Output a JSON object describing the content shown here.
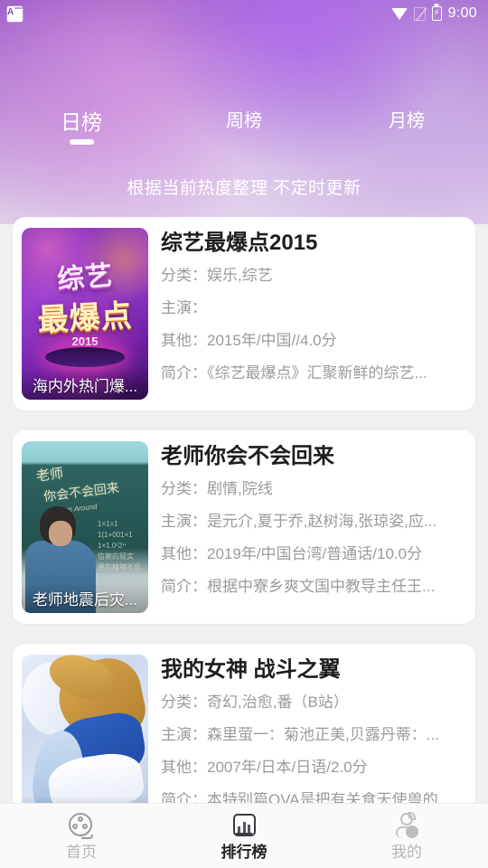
{
  "status_bar": {
    "app_icon": "app-notification-icon",
    "wifi_icon": "wifi-icon",
    "signal_icon": "no-sim-signal-icon",
    "battery_icon": "battery-charging-icon",
    "time": "9:00"
  },
  "header": {
    "tabs": [
      {
        "label": "日榜",
        "active": true
      },
      {
        "label": "周榜",
        "active": false
      },
      {
        "label": "月榜",
        "active": false
      }
    ],
    "subtitle": "根据当前热度整理 不定时更新",
    "accent_color": "#ffffff",
    "gradient_from": "#9757c4",
    "gradient_to": "#e3d5ea"
  },
  "list": {
    "items": [
      {
        "title": "综艺最爆点2015",
        "poster_caption": "海内外热门爆...",
        "poster_title_line1": "综艺",
        "poster_title_line2": "最爆点",
        "poster_year": "2015",
        "rows": [
          {
            "label": "分类：",
            "value": "娱乐,综艺"
          },
          {
            "label": "主演：",
            "value": ""
          },
          {
            "label": "其他：",
            "value": "2015年/中国//4.0分"
          },
          {
            "label": "简介：",
            "value": "《综艺最爆点》汇聚新鲜的综艺..."
          }
        ]
      },
      {
        "title": "老师你会不会回来",
        "poster_caption": "老师地震后灾...",
        "poster_chalk_line1": "老师",
        "poster_chalk_line2": "你会不会回来",
        "poster_chalk_sub": "Turn Around",
        "poster_equations": "1×1=1\n1(1+001×1.n1\n1×1.01^2×2...\n信赖nn1的现实\n患n精神不乐",
        "rows": [
          {
            "label": "分类：",
            "value": "剧情,院线"
          },
          {
            "label": "主演：",
            "value": "是元介,夏于乔,赵树海,张琼姿,应..."
          },
          {
            "label": "其他：",
            "value": "2019年/中国台湾/普通话/10.0分"
          },
          {
            "label": "简介：",
            "value": "根据中寮乡爽文国中教导主任王..."
          }
        ]
      },
      {
        "title": "我的女神 战斗之翼",
        "poster_caption": "",
        "rows": [
          {
            "label": "分类：",
            "value": "奇幻,治愈,番（B站）"
          },
          {
            "label": "主演：",
            "value": "森里萤一：菊池正美,贝露丹蒂：..."
          },
          {
            "label": "其他：",
            "value": "2007年/日本/日语/2.0分"
          },
          {
            "label": "简介：",
            "value": "本特别篇OVA是把有关食天使兽的..."
          }
        ]
      }
    ]
  },
  "bottom_nav": {
    "items": [
      {
        "label": "首页",
        "icon": "film-reel-icon",
        "active": false
      },
      {
        "label": "排行榜",
        "icon": "bar-chart-icon",
        "active": true
      },
      {
        "label": "我的",
        "icon": "person-icon",
        "active": false
      }
    ],
    "active_color": "#222226",
    "inactive_color": "#b4b4b8"
  }
}
